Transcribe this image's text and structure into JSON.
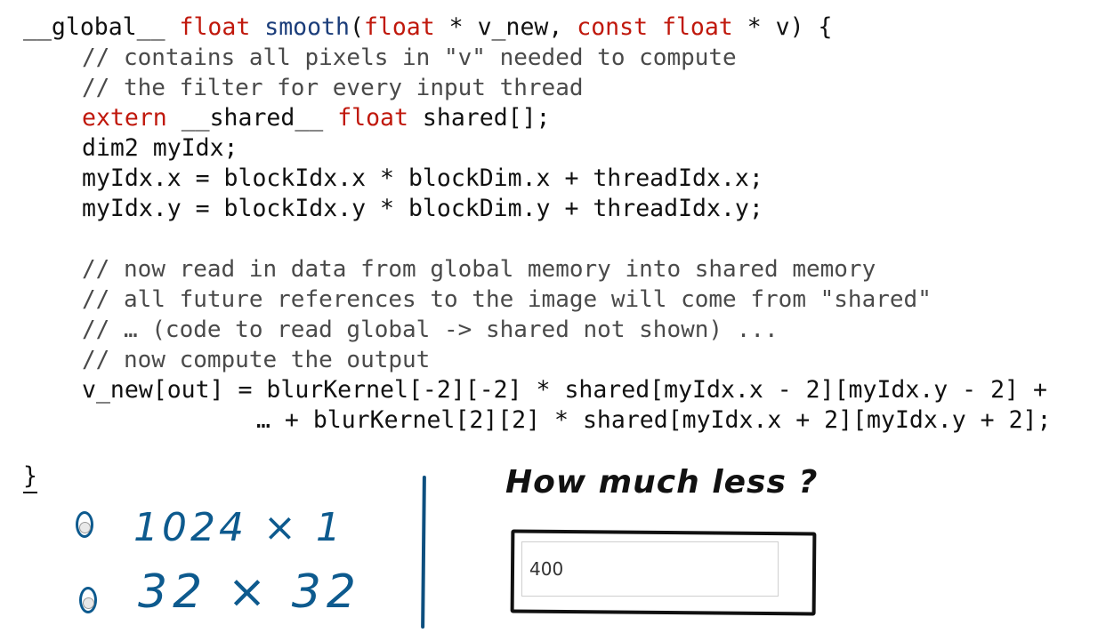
{
  "code": {
    "line1": {
      "a": "__global__ ",
      "b": "float ",
      "c": "smooth",
      "d": "(",
      "e": "float",
      "f": " * v_new, ",
      "g": "const float",
      "h": " * v) {"
    },
    "comment1": "// contains all pixels in \"v\" needed to compute",
    "comment2": "// the filter for every input thread",
    "line4": {
      "a": "extern",
      "b": " __shared__ ",
      "c": "float",
      "d": " shared[];"
    },
    "line5": "dim2 myIdx;",
    "line6": "myIdx.x = blockIdx.x * blockDim.x + threadIdx.x;",
    "line7": "myIdx.y = blockIdx.y * blockDim.y + threadIdx.y;",
    "comment3": "// now read in data from global memory into shared memory",
    "comment4": "// all future references to the image will come from \"shared\"",
    "comment5": "// … (code to read global -> shared not shown) ...",
    "comment6": "// now compute the output",
    "line12": "v_new[out] = blurKernel[-2][-2] * shared[myIdx.x - 2][myIdx.y - 2] +",
    "line13": "… + blurKernel[2][2] * shared[myIdx.x + 2][myIdx.y + 2];",
    "closing_brace": "}"
  },
  "quiz": {
    "options": [
      {
        "label": "1024 × 1",
        "selected": false
      },
      {
        "label": "32 × 32",
        "selected": false
      }
    ],
    "question": "How much less ?",
    "answer_value": "400"
  },
  "colors": {
    "keyword": "#c0180c",
    "function": "#1b3d7a",
    "handwriting": "#0d5a8e"
  }
}
